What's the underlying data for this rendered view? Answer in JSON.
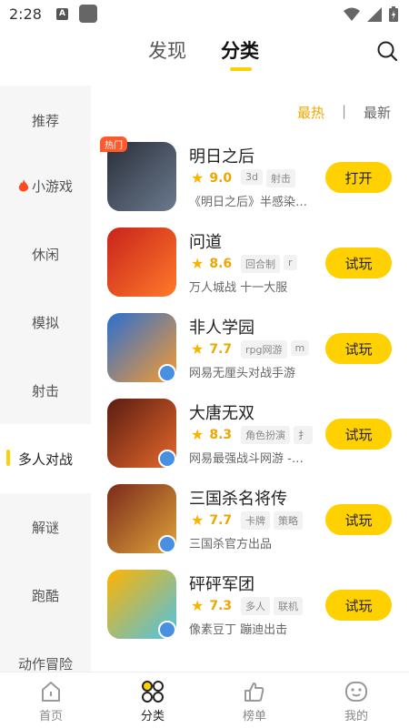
{
  "status_bar": {
    "time": "2:28",
    "notif_letter": "A"
  },
  "header": {
    "tabs": [
      "发现",
      "分类"
    ],
    "active_tab": "分类"
  },
  "sidebar": {
    "items": [
      {
        "label": "推荐"
      },
      {
        "label": "小游戏",
        "icon": "fire-icon"
      },
      {
        "label": "休闲"
      },
      {
        "label": "模拟"
      },
      {
        "label": "射击"
      },
      {
        "label": "多人对战",
        "active": true
      },
      {
        "label": "解谜"
      },
      {
        "label": "跑酷"
      },
      {
        "label": "动作冒险"
      }
    ]
  },
  "sort": {
    "hot": "最热",
    "separator": "|",
    "new": "最新",
    "active": "最热"
  },
  "games": [
    {
      "name": "明日之后",
      "rating": "9.0",
      "tags": [
        "3d",
        "射击"
      ],
      "desc": "《明日之后》半感染…",
      "button": "打开",
      "badge": "热门",
      "colors": [
        "#2a2f3a",
        "#6b7a8f"
      ]
    },
    {
      "name": "问道",
      "rating": "8.6",
      "tags": [
        "回合制",
        "r"
      ],
      "desc": "万人城战 十一大服",
      "button": "试玩",
      "colors": [
        "#c8231b",
        "#ff7a2a"
      ]
    },
    {
      "name": "非人学园",
      "rating": "7.7",
      "tags": [
        "rpg网游",
        "m"
      ],
      "desc": "网易无厘头对战手游",
      "button": "试玩",
      "colors": [
        "#2b6fd1",
        "#f59b30"
      ]
    },
    {
      "name": "大唐无双",
      "rating": "8.3",
      "tags": [
        "角色扮演",
        "扌"
      ],
      "desc": "网易最强战斗网游 -…",
      "button": "试玩",
      "colors": [
        "#5a1d12",
        "#e6682b"
      ]
    },
    {
      "name": "三国杀名将传",
      "rating": "7.7",
      "tags": [
        "卡牌",
        "策略"
      ],
      "desc": "三国杀官方出品",
      "button": "试玩",
      "colors": [
        "#7a2a1b",
        "#e0a33a"
      ]
    },
    {
      "name": "砰砰军团",
      "rating": "7.3",
      "tags": [
        "多人",
        "联机"
      ],
      "desc": "像素豆丁 蹦迪出击",
      "button": "试玩",
      "colors": [
        "#ffb400",
        "#4cc3e8"
      ]
    }
  ],
  "bottom_nav": [
    {
      "label": "首页",
      "icon": "home-icon"
    },
    {
      "label": "分类",
      "icon": "category-icon",
      "active": true
    },
    {
      "label": "榜单",
      "icon": "ranking-icon"
    },
    {
      "label": "我的",
      "icon": "profile-icon"
    }
  ],
  "colors": {
    "accent": "#ffd100",
    "accent_text": "#f0a500",
    "sidebar_bg": "#f6f6f6"
  }
}
